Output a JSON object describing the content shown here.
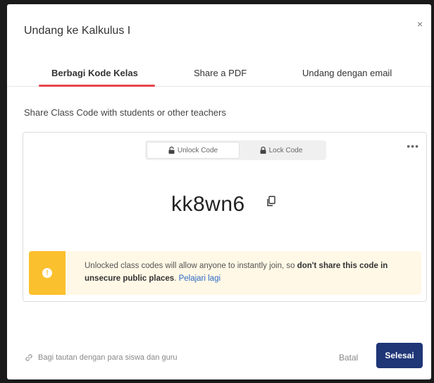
{
  "modal": {
    "title": "Undang ke Kalkulus I",
    "close_glyph": "×"
  },
  "tabs": [
    {
      "label": "Berbagi Kode Kelas",
      "active": true
    },
    {
      "label": "Share a PDF",
      "active": false
    },
    {
      "label": "Undang dengan email",
      "active": false
    }
  ],
  "subtitle": "Share Class Code with students or other teachers",
  "card": {
    "toggle": {
      "unlock_label": "Unlock Code",
      "lock_label": "Lock Code",
      "selected": "Unlock Code"
    },
    "more_glyph": "•••",
    "class_code": "kk8wn6"
  },
  "warning": {
    "text_before": "Unlocked class codes will allow anyone to instantly join, so ",
    "bold_text": "don't share this code in unsecure public places",
    "text_after": ". ",
    "link_label": "Pelajari lagi",
    "icon_glyph": "!"
  },
  "footer": {
    "share_link_label": "Bagi tautan dengan para siswa dan guru",
    "cancel_label": "Batal",
    "done_label": "Selesai"
  },
  "colors": {
    "accent_tab": "#e8434e",
    "primary_button": "#1f3677",
    "warning_stripe": "#fbc02d",
    "warning_bg": "#fff8e6",
    "link": "#2e6ac7"
  },
  "icons": [
    "close-icon",
    "unlock-icon",
    "lock-icon",
    "more-icon",
    "copy-icon",
    "info-icon",
    "link-icon"
  ]
}
